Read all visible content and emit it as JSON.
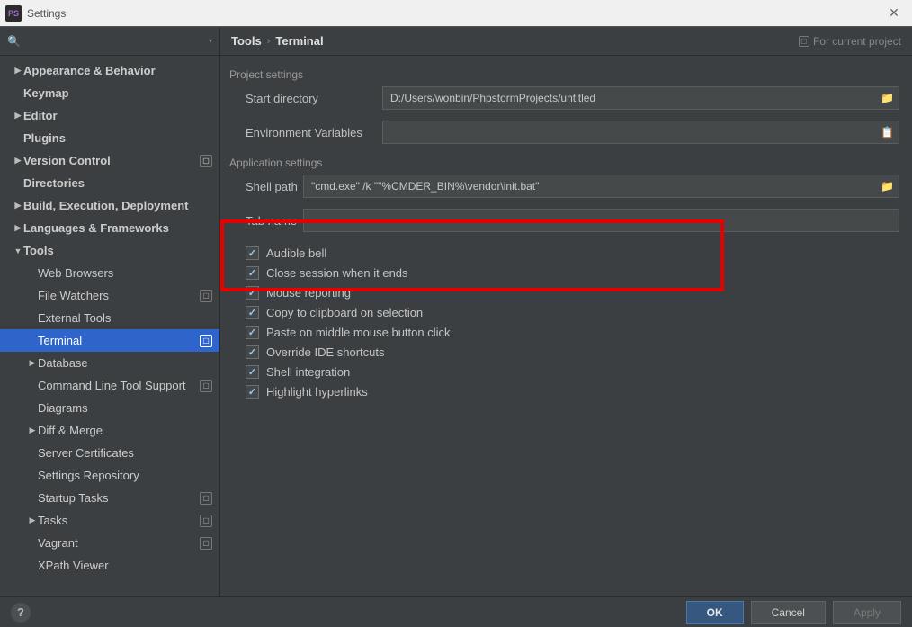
{
  "window": {
    "title": "Settings",
    "logo_text": "PS"
  },
  "search": {
    "placeholder": ""
  },
  "sidebar": {
    "items": [
      {
        "label": "Appearance & Behavior",
        "bold": true,
        "arrow": "right",
        "depth": 0,
        "badge": false
      },
      {
        "label": "Keymap",
        "bold": true,
        "arrow": "",
        "depth": 0,
        "badge": false
      },
      {
        "label": "Editor",
        "bold": true,
        "arrow": "right",
        "depth": 0,
        "badge": false
      },
      {
        "label": "Plugins",
        "bold": true,
        "arrow": "",
        "depth": 0,
        "badge": false
      },
      {
        "label": "Version Control",
        "bold": true,
        "arrow": "right",
        "depth": 0,
        "badge": true
      },
      {
        "label": "Directories",
        "bold": true,
        "arrow": "",
        "depth": 0,
        "badge": false
      },
      {
        "label": "Build, Execution, Deployment",
        "bold": true,
        "arrow": "right",
        "depth": 0,
        "badge": false
      },
      {
        "label": "Languages & Frameworks",
        "bold": true,
        "arrow": "right",
        "depth": 0,
        "badge": false
      },
      {
        "label": "Tools",
        "bold": true,
        "arrow": "down",
        "depth": 0,
        "badge": false
      },
      {
        "label": "Web Browsers",
        "bold": false,
        "arrow": "",
        "depth": 1,
        "badge": false
      },
      {
        "label": "File Watchers",
        "bold": false,
        "arrow": "",
        "depth": 1,
        "badge": true
      },
      {
        "label": "External Tools",
        "bold": false,
        "arrow": "",
        "depth": 1,
        "badge": false
      },
      {
        "label": "Terminal",
        "bold": false,
        "arrow": "",
        "depth": 1,
        "badge": true,
        "selected": true
      },
      {
        "label": "Database",
        "bold": false,
        "arrow": "right",
        "depth": 1,
        "badge": false
      },
      {
        "label": "Command Line Tool Support",
        "bold": false,
        "arrow": "",
        "depth": 1,
        "badge": true
      },
      {
        "label": "Diagrams",
        "bold": false,
        "arrow": "",
        "depth": 1,
        "badge": false
      },
      {
        "label": "Diff & Merge",
        "bold": false,
        "arrow": "right",
        "depth": 1,
        "badge": false
      },
      {
        "label": "Server Certificates",
        "bold": false,
        "arrow": "",
        "depth": 1,
        "badge": false
      },
      {
        "label": "Settings Repository",
        "bold": false,
        "arrow": "",
        "depth": 1,
        "badge": false
      },
      {
        "label": "Startup Tasks",
        "bold": false,
        "arrow": "",
        "depth": 1,
        "badge": true
      },
      {
        "label": "Tasks",
        "bold": false,
        "arrow": "right",
        "depth": 1,
        "badge": true
      },
      {
        "label": "Vagrant",
        "bold": false,
        "arrow": "",
        "depth": 1,
        "badge": true
      },
      {
        "label": "XPath Viewer",
        "bold": false,
        "arrow": "",
        "depth": 1,
        "badge": false
      }
    ]
  },
  "breadcrumb": {
    "root": "Tools",
    "leaf": "Terminal",
    "hint": "For current project"
  },
  "project_settings": {
    "title": "Project settings",
    "start_dir_label": "Start directory",
    "start_dir_value": "D:/Users/wonbin/PhpstormProjects/untitled",
    "env_label": "Environment Variables",
    "env_value": ""
  },
  "app_settings": {
    "title": "Application settings",
    "shell_path_label": "Shell path",
    "shell_path_value": "\"cmd.exe\" /k \"\"%CMDER_BIN%\\vendor\\init.bat\"",
    "tab_name_label": "Tab name",
    "tab_name_value": "",
    "checks": [
      {
        "label": "Audible bell",
        "checked": true
      },
      {
        "label": "Close session when it ends",
        "checked": true
      },
      {
        "label": "Mouse reporting",
        "checked": true
      },
      {
        "label": "Copy to clipboard on selection",
        "checked": true
      },
      {
        "label": "Paste on middle mouse button click",
        "checked": true
      },
      {
        "label": "Override IDE shortcuts",
        "checked": true
      },
      {
        "label": "Shell integration",
        "checked": true
      },
      {
        "label": "Highlight hyperlinks",
        "checked": true
      }
    ]
  },
  "footer": {
    "ok": "OK",
    "cancel": "Cancel",
    "apply": "Apply"
  }
}
